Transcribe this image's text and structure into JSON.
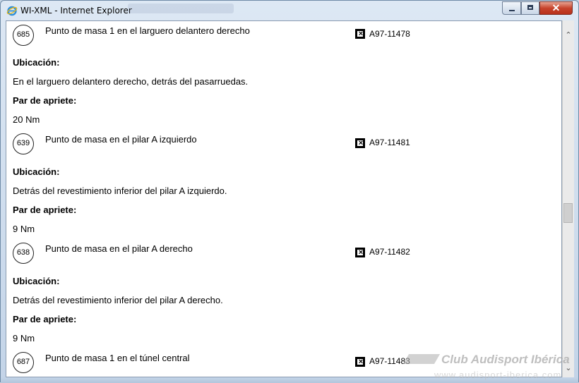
{
  "window": {
    "title": "WI-XML - Internet Explorer"
  },
  "controls": {
    "close_glyph": "✕"
  },
  "scrollbar": {
    "up_glyph": "⌃",
    "down_glyph": "⌄"
  },
  "entries": [
    {
      "number": "685",
      "heading": "Punto de masa 1 en el larguero delantero derecho",
      "ref": "A97-11478",
      "location_label": "Ubicación:",
      "location_text": "En el larguero delantero derecho, detrás del pasarruedas.",
      "torque_label": "Par de apriete:",
      "torque_value": "20 Nm"
    },
    {
      "number": "639",
      "heading": "Punto de masa en el pilar A izquierdo",
      "ref": "A97-11481",
      "location_label": "Ubicación:",
      "location_text": "Detrás del revestimiento inferior del pilar A izquierdo.",
      "torque_label": "Par de apriete:",
      "torque_value": "9 Nm"
    },
    {
      "number": "638",
      "heading": "Punto de masa en el pilar A derecho",
      "ref": "A97-11482",
      "location_label": "Ubicación:",
      "location_text": "Detrás del revestimiento inferior del pilar A derecho.",
      "torque_label": "Par de apriete:",
      "torque_value": "9 Nm"
    },
    {
      "number": "687",
      "heading": "Punto de masa 1 en el túnel central",
      "ref": "A97-11483"
    }
  ],
  "watermark": {
    "text": "Club Audisport Ibérica",
    "sub": "www.audisport-iberica.com"
  }
}
